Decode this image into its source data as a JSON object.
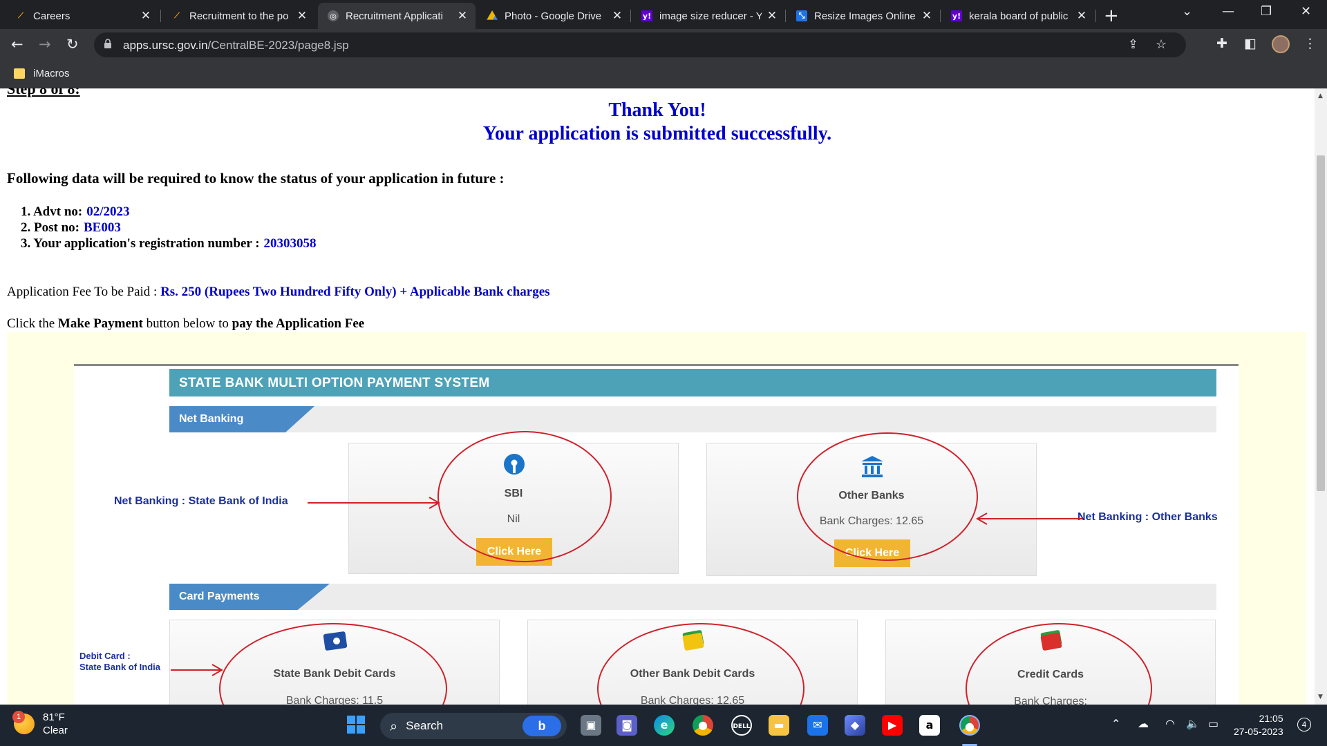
{
  "browser": {
    "tabs": [
      {
        "title": "Careers",
        "favicon": "isro-icon",
        "active": false
      },
      {
        "title": "Recruitment to the po",
        "favicon": "isro-icon",
        "active": false
      },
      {
        "title": "Recruitment Applicati",
        "favicon": "globe-icon",
        "active": true
      },
      {
        "title": "Photo - Google Drive",
        "favicon": "google-drive-icon",
        "active": false
      },
      {
        "title": "image size reducer - Y",
        "favicon": "yahoo-icon",
        "active": false
      },
      {
        "title": "Resize Images Online",
        "favicon": "resize-icon",
        "active": false
      },
      {
        "title": "kerala board of public",
        "favicon": "yahoo-icon",
        "active": false
      }
    ],
    "url_host": "apps.ursc.gov.in",
    "url_path": "/CentralBE-2023/page8.jsp",
    "bookmarks": [
      {
        "label": "iMacros"
      }
    ]
  },
  "page": {
    "step_label": "Step 8 of 8:",
    "thank_you": "Thank You!",
    "submitted": "Your application is submitted successfully.",
    "required_heading": "Following data will be required to know the status of your application in future :",
    "items": [
      {
        "label": "1. Advt no:",
        "value": "02/2023"
      },
      {
        "label": "2. Post no:",
        "value": "BE003"
      },
      {
        "label": "3. Your application's registration number :",
        "value": "20303058"
      }
    ],
    "fee_label": "Application Fee To be Paid :",
    "fee_value": "Rs. 250 (Rupees Two Hundred Fifty Only) + Applicable Bank charges",
    "click_pre": "Click the",
    "click_bold": "Make Payment",
    "click_mid": "button below to",
    "click_end": "pay the Application Fee"
  },
  "payment": {
    "header": "STATE BANK MULTI OPTION PAYMENT SYSTEM",
    "net_banking_label": "Net Banking",
    "card_payments_label": "Card Payments",
    "sbi": {
      "name": "SBI",
      "charges": "Nil",
      "button": "Click Here"
    },
    "other_banks": {
      "name": "Other Banks",
      "charges": "Bank Charges: 12.65",
      "button": "Click Here"
    },
    "sbi_debit": {
      "name": "State Bank Debit Cards",
      "charges": "Bank Charges: 11.5"
    },
    "other_debit": {
      "name": "Other Bank Debit Cards",
      "charges": "Bank Charges: 12.65"
    },
    "credit": {
      "name": "Credit Cards",
      "charges": "Bank Charges:"
    },
    "annot_sbi": "Net Banking : State Bank of India",
    "annot_other": "Net Banking : Other Banks",
    "annot_debit_1": "Debit Card :",
    "annot_debit_2": "State Bank of India"
  },
  "taskbar": {
    "temperature": "81°F",
    "condition": "Clear",
    "weather_badge": "1",
    "search_label": "Search",
    "time": "21:05",
    "date": "27-05-2023",
    "notifications": "4"
  }
}
